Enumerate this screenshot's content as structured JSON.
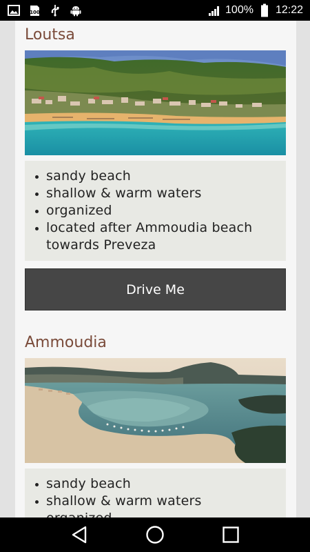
{
  "status_bar": {
    "icons_left": [
      "image-icon",
      "storage-100-icon",
      "usb-icon",
      "android-icon"
    ],
    "storage_text": "100",
    "battery": "100%",
    "time": "12:22"
  },
  "sections": [
    {
      "title": "Loutsa",
      "image": "loutsa-beach-photo",
      "features": [
        "sandy beach",
        "shallow & warm waters",
        "organized",
        "located after Ammoudia beach towards Preveza"
      ],
      "button_label": "Drive Me"
    },
    {
      "title": "Ammoudia",
      "image": "ammoudia-beach-photo",
      "features": [
        "sandy beach",
        "shallow & warm waters",
        "organized"
      ]
    }
  ],
  "nav_bar": {
    "icons": [
      "back-icon",
      "home-icon",
      "recents-icon"
    ]
  },
  "colors": {
    "title": "#7a4b3a",
    "button": "#464646",
    "list_bg": "#e8e9e4",
    "card_bg": "#f6f6f6"
  }
}
